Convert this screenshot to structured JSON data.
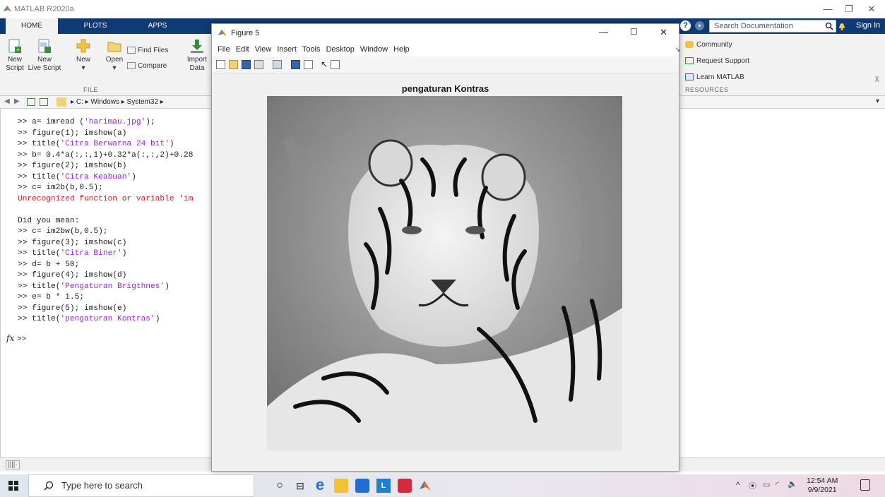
{
  "window": {
    "title": "MATLAB R2020a"
  },
  "ribbon": {
    "tabs": [
      "HOME",
      "PLOTS",
      "APPS"
    ],
    "new_script": [
      "New",
      "Script"
    ],
    "new_live": [
      "New",
      "Live Script"
    ],
    "new": "New",
    "open": "Open",
    "find_files": "Find Files",
    "compare": "Compare",
    "import": [
      "Import",
      "Data"
    ],
    "group_file": "FILE",
    "search_placeholder": "Search Documentation",
    "sign_in": "Sign In",
    "community": "Community",
    "request_support": "Request Support",
    "learn": "Learn MATLAB",
    "group_resources": "RESOURCES"
  },
  "address": {
    "path": [
      "C:",
      "Windows",
      "System32"
    ]
  },
  "command_window": {
    "lines": [
      {
        "p": ">> a= imread (",
        "s": "'harimau.jpg'",
        "e": ");"
      },
      {
        "p": ">> figure(1); imshow(a)",
        "s": "",
        "e": ""
      },
      {
        "p": ">> title(",
        "s": "'Citra Berwarna 24 bit'",
        "e": ")"
      },
      {
        "p": ">> b= 0.4*a(:,:,1)+0.32*a(:,:,2)+0.28",
        "s": "",
        "e": ""
      },
      {
        "p": ">> figure(2); imshow(b)",
        "s": "",
        "e": ""
      },
      {
        "p": ">> title(",
        "s": "'Citra Keabuan'",
        "e": ")"
      },
      {
        "p": ">> c= im2b(b,0.5);",
        "s": "",
        "e": ""
      },
      {
        "err": "Unrecognized function or variable 'im"
      },
      {
        "p": "",
        "s": "",
        "e": ""
      },
      {
        "p": "Did you mean:",
        "s": "",
        "e": ""
      },
      {
        "p": ">> c= im2bw(b,0.5);",
        "s": "",
        "e": ""
      },
      {
        "p": ">> figure(3); imshow(c)",
        "s": "",
        "e": ""
      },
      {
        "p": ">> title(",
        "s": "'Citra Biner'",
        "e": ")"
      },
      {
        "p": ">> d= b + 50;",
        "s": "",
        "e": ""
      },
      {
        "p": ">> figure(4); imshow(d)",
        "s": "",
        "e": ""
      },
      {
        "p": ">> title(",
        "s": "'Pengaturan Brigthnes'",
        "e": ")"
      },
      {
        "p": ">> e= b * 1.5;",
        "s": "",
        "e": ""
      },
      {
        "p": ">> figure(5); imshow(e)",
        "s": "",
        "e": ""
      },
      {
        "p": ">> title(",
        "s": "'pengaturan Kontras'",
        "e": ")"
      }
    ],
    "fx": "fx",
    "prompt": ">>"
  },
  "figure": {
    "title": "Figure 5",
    "menu": [
      "File",
      "Edit",
      "View",
      "Insert",
      "Tools",
      "Desktop",
      "Window",
      "Help"
    ],
    "axes_title": "pengaturan Kontras"
  },
  "taskbar": {
    "search_placeholder": "Type here to search",
    "time": "12:54 AM",
    "date": "9/9/2021"
  },
  "colors": {
    "ribbon_tab_bg": "#0d3b75",
    "matlab_orange": "#e0701f",
    "string": "#a020f0",
    "error": "#e02020"
  }
}
